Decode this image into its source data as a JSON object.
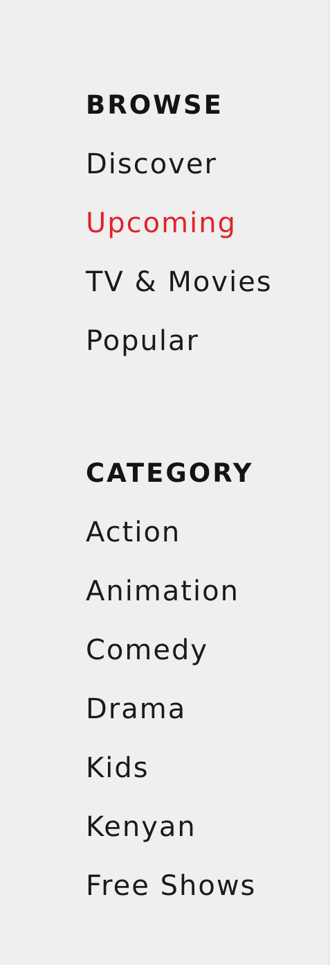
{
  "colors": {
    "background": "#efefef",
    "text": "#1a1a1a",
    "active": "#e0232b"
  },
  "browse": {
    "heading": "BROWSE",
    "items": [
      {
        "label": "Discover",
        "active": false
      },
      {
        "label": "Upcoming",
        "active": true
      },
      {
        "label": "TV & Movies",
        "active": false
      },
      {
        "label": "Popular",
        "active": false
      }
    ]
  },
  "category": {
    "heading": "CATEGORY",
    "items": [
      {
        "label": "Action"
      },
      {
        "label": "Animation"
      },
      {
        "label": "Comedy"
      },
      {
        "label": "Drama"
      },
      {
        "label": "Kids"
      },
      {
        "label": "Kenyan"
      },
      {
        "label": "Free Shows"
      }
    ]
  }
}
